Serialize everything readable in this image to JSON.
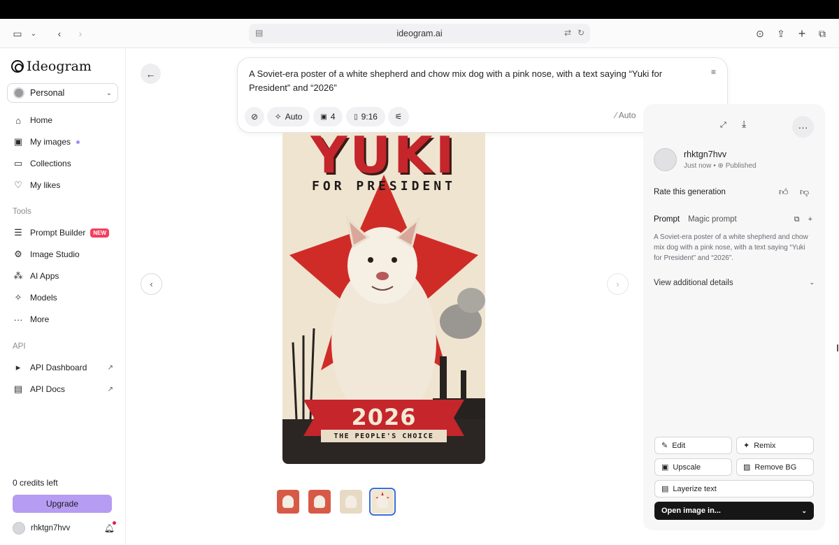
{
  "browser": {
    "url": "ideogram.ai"
  },
  "sidebar": {
    "brand": "Ideogram",
    "workspace": "Personal",
    "nav": [
      {
        "label": "Home"
      },
      {
        "label": "My images"
      },
      {
        "label": "Collections"
      },
      {
        "label": "My likes"
      }
    ],
    "tools_heading": "Tools",
    "tools": [
      {
        "label": "Prompt Builder",
        "badge": "NEW"
      },
      {
        "label": "Image Studio"
      },
      {
        "label": "AI Apps"
      },
      {
        "label": "Models"
      },
      {
        "label": "More"
      }
    ],
    "api_heading": "API",
    "api": [
      {
        "label": "API Dashboard"
      },
      {
        "label": "API Docs"
      }
    ],
    "credits": "0 credits left",
    "upgrade_label": "Upgrade",
    "username": "rhktgn7hvv"
  },
  "prompt_card": {
    "text": "A Soviet-era poster of a white shepherd and chow mix dog with a pink nose, with a text saying “Yuki for President” and “2026”",
    "style_label": "Auto",
    "image_count": "4",
    "aspect_ratio": "9:16",
    "magic_label": "Auto"
  },
  "poster": {
    "headline": "YUKI",
    "subline": "FOR PRESIDENT",
    "year": "2026",
    "tagline": "THE PEOPLE'S CHOICE"
  },
  "thumbnails": {
    "count": 4,
    "selected_index": 3
  },
  "panel": {
    "username": "rhktgn7hvv",
    "time": "Just now",
    "visibility": "Published",
    "rate_label": "Rate this generation",
    "tab_prompt": "Prompt",
    "tab_magic": "Magic prompt",
    "prompt_text": "A Soviet-era poster of a white shepherd and chow mix dog with a pink nose, with a text saying “Yuki for President” and “2026”.",
    "details_label": "View additional details",
    "actions": {
      "edit": "Edit",
      "remix": "Remix",
      "upscale": "Upscale",
      "remove_bg": "Remove BG",
      "layerize": "Layerize text",
      "open_in": "Open image in..."
    }
  },
  "colors": {
    "accent_purple": "#b69cf3",
    "badge_red": "#f43f5e",
    "poster_red": "#c4262b",
    "poster_cream": "#efe4cf"
  }
}
